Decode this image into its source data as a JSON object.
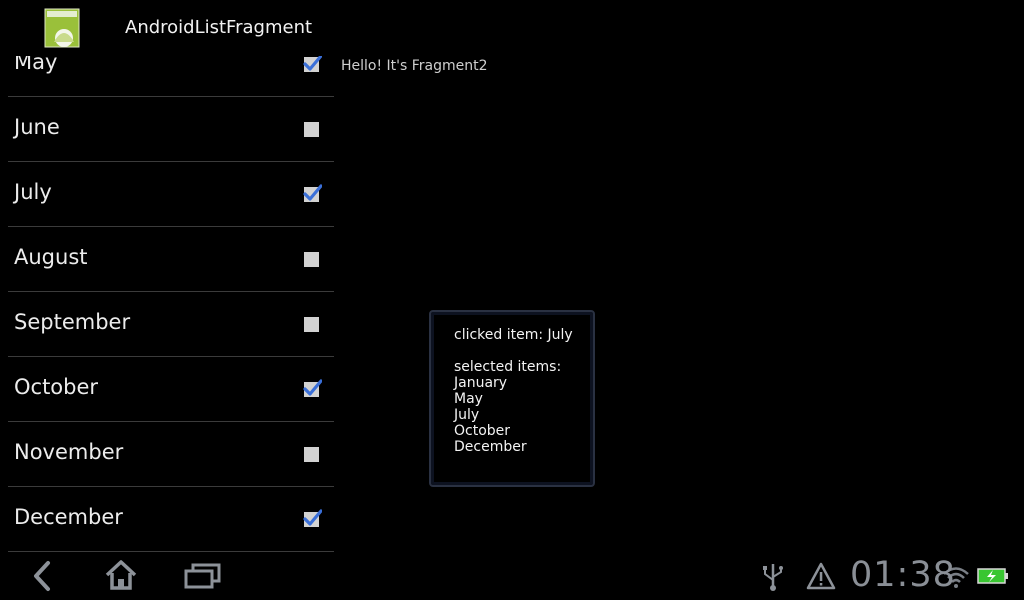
{
  "app": {
    "title": "AndroidListFragment"
  },
  "list": {
    "items": [
      {
        "label": "May",
        "checked": true
      },
      {
        "label": "June",
        "checked": false
      },
      {
        "label": "July",
        "checked": true
      },
      {
        "label": "August",
        "checked": false
      },
      {
        "label": "September",
        "checked": false
      },
      {
        "label": "October",
        "checked": true
      },
      {
        "label": "November",
        "checked": false
      },
      {
        "label": "December",
        "checked": true
      }
    ]
  },
  "fragment2": {
    "text": "Hello! It's Fragment2"
  },
  "toast": {
    "clicked": "clicked item: July",
    "selected_header": "selected items:",
    "selected": [
      "January",
      "May",
      "July",
      "October",
      "December"
    ]
  },
  "status_bar": {
    "time": "01:38"
  },
  "icons": {
    "app": "android-app-icon",
    "back": "back-icon",
    "home": "home-icon",
    "recents": "recent-apps-icon",
    "usb": "usb-icon",
    "warning": "warning-icon",
    "wifi": "wifi-icon",
    "battery": "battery-charging-icon"
  },
  "colors": {
    "check": "#3a6fd8",
    "accent_battery": "#39c631"
  }
}
